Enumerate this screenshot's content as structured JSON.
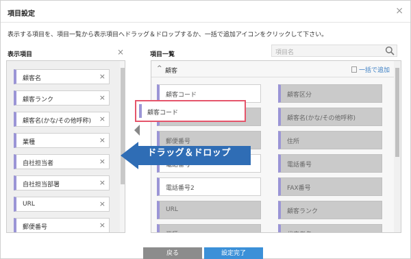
{
  "dialog": {
    "title": "項目設定",
    "close_glyph": "×",
    "instruction": "表示する項目を、項目一覧から表示項目へドラッグ＆ドロップするか、一括で追加アイコンをクリックして下さい。"
  },
  "left": {
    "title": "表示項目",
    "clear_glyph": "×",
    "remove_glyph": "×",
    "items": [
      {
        "label": "顧客名"
      },
      {
        "label": "顧客ランク"
      },
      {
        "label": "顧客名(かな/その他呼称)"
      },
      {
        "label": "業種"
      },
      {
        "label": "自社担当者"
      },
      {
        "label": "自社担当部署"
      },
      {
        "label": "URL"
      },
      {
        "label": "郵便番号"
      }
    ]
  },
  "right": {
    "title": "項目一覧",
    "search_placeholder": "項目名",
    "group_caret": "^",
    "group_name": "顧客",
    "bulk_add": "一括で追加",
    "items": [
      {
        "label": "顧客コード",
        "state": "available"
      },
      {
        "label": "顧客区分",
        "state": "used"
      },
      {
        "label": "",
        "state": "used"
      },
      {
        "label": "顧客名(かな/その他呼称)",
        "state": "used"
      },
      {
        "label": "郵便番号",
        "state": "used"
      },
      {
        "label": "住所",
        "state": "used"
      },
      {
        "label": "電話番号",
        "state": "available"
      },
      {
        "label": "電話番号",
        "state": "used"
      },
      {
        "label": "電話番号2",
        "state": "available"
      },
      {
        "label": "FAX番号",
        "state": "used"
      },
      {
        "label": "URL",
        "state": "used"
      },
      {
        "label": "顧客ランク",
        "state": "used"
      },
      {
        "label": "業種",
        "state": "used"
      },
      {
        "label": "代表者名",
        "state": "used"
      }
    ]
  },
  "drag": {
    "ghost_label": "顧客コード",
    "callout": "ドラッグ＆ドロップ",
    "callout_color": "#2f6db5"
  },
  "footer": {
    "back_label": "戻る",
    "done_label": "設定完了"
  },
  "colors": {
    "accent": "#3b90d8",
    "item_stripe": "#9b95d6",
    "highlight": "#e5546a"
  }
}
